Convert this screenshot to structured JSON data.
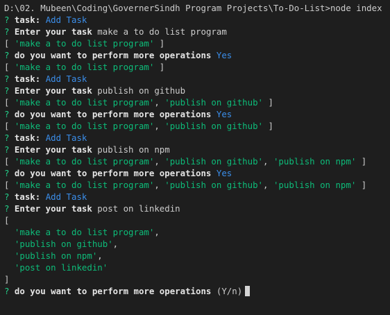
{
  "terminal": {
    "lines": [
      [
        {
          "t": "D:\\02. Mubeen\\Coding\\GovernerSindh Program Projects\\To-Do-List>node index",
          "c": "plain"
        }
      ],
      [
        {
          "t": "? ",
          "c": "q"
        },
        {
          "t": "task:",
          "c": "bold"
        },
        {
          "t": " ",
          "c": "plain"
        },
        {
          "t": "Add Task",
          "c": "ans"
        }
      ],
      [
        {
          "t": "? ",
          "c": "q"
        },
        {
          "t": "Enter your task",
          "c": "bold"
        },
        {
          "t": " make a to do list program",
          "c": "plain"
        }
      ],
      [
        {
          "t": "[ ",
          "c": "plain"
        },
        {
          "t": "'make a to do list program'",
          "c": "str"
        },
        {
          "t": " ]",
          "c": "plain"
        }
      ],
      [
        {
          "t": "? ",
          "c": "q"
        },
        {
          "t": "do you want to perform more operations",
          "c": "bold"
        },
        {
          "t": " ",
          "c": "plain"
        },
        {
          "t": "Yes",
          "c": "ans"
        }
      ],
      [
        {
          "t": "[ ",
          "c": "plain"
        },
        {
          "t": "'make a to do list program'",
          "c": "str"
        },
        {
          "t": " ]",
          "c": "plain"
        }
      ],
      [
        {
          "t": "? ",
          "c": "q"
        },
        {
          "t": "task:",
          "c": "bold"
        },
        {
          "t": " ",
          "c": "plain"
        },
        {
          "t": "Add Task",
          "c": "ans"
        }
      ],
      [
        {
          "t": "? ",
          "c": "q"
        },
        {
          "t": "Enter your task",
          "c": "bold"
        },
        {
          "t": " publish on github",
          "c": "plain"
        }
      ],
      [
        {
          "t": "[ ",
          "c": "plain"
        },
        {
          "t": "'make a to do list program'",
          "c": "str"
        },
        {
          "t": ", ",
          "c": "plain"
        },
        {
          "t": "'publish on github'",
          "c": "str"
        },
        {
          "t": " ]",
          "c": "plain"
        }
      ],
      [
        {
          "t": "? ",
          "c": "q"
        },
        {
          "t": "do you want to perform more operations",
          "c": "bold"
        },
        {
          "t": " ",
          "c": "plain"
        },
        {
          "t": "Yes",
          "c": "ans"
        }
      ],
      [
        {
          "t": "[ ",
          "c": "plain"
        },
        {
          "t": "'make a to do list program'",
          "c": "str"
        },
        {
          "t": ", ",
          "c": "plain"
        },
        {
          "t": "'publish on github'",
          "c": "str"
        },
        {
          "t": " ]",
          "c": "plain"
        }
      ],
      [
        {
          "t": "? ",
          "c": "q"
        },
        {
          "t": "task:",
          "c": "bold"
        },
        {
          "t": " ",
          "c": "plain"
        },
        {
          "t": "Add Task",
          "c": "ans"
        }
      ],
      [
        {
          "t": "? ",
          "c": "q"
        },
        {
          "t": "Enter your task",
          "c": "bold"
        },
        {
          "t": " publish on npm",
          "c": "plain"
        }
      ],
      [
        {
          "t": "[ ",
          "c": "plain"
        },
        {
          "t": "'make a to do list program'",
          "c": "str"
        },
        {
          "t": ", ",
          "c": "plain"
        },
        {
          "t": "'publish on github'",
          "c": "str"
        },
        {
          "t": ", ",
          "c": "plain"
        },
        {
          "t": "'publish on npm'",
          "c": "str"
        },
        {
          "t": " ]",
          "c": "plain"
        }
      ],
      [
        {
          "t": "? ",
          "c": "q"
        },
        {
          "t": "do you want to perform more operations",
          "c": "bold"
        },
        {
          "t": " ",
          "c": "plain"
        },
        {
          "t": "Yes",
          "c": "ans"
        }
      ],
      [
        {
          "t": "[ ",
          "c": "plain"
        },
        {
          "t": "'make a to do list program'",
          "c": "str"
        },
        {
          "t": ", ",
          "c": "plain"
        },
        {
          "t": "'publish on github'",
          "c": "str"
        },
        {
          "t": ", ",
          "c": "plain"
        },
        {
          "t": "'publish on npm'",
          "c": "str"
        },
        {
          "t": " ]",
          "c": "plain"
        }
      ],
      [
        {
          "t": "? ",
          "c": "q"
        },
        {
          "t": "task:",
          "c": "bold"
        },
        {
          "t": " ",
          "c": "plain"
        },
        {
          "t": "Add Task",
          "c": "ans"
        }
      ],
      [
        {
          "t": "? ",
          "c": "q"
        },
        {
          "t": "Enter your task",
          "c": "bold"
        },
        {
          "t": " post on linkedin",
          "c": "plain"
        }
      ],
      [
        {
          "t": "[",
          "c": "plain"
        }
      ],
      [
        {
          "t": "  ",
          "c": "plain"
        },
        {
          "t": "'make a to do list program'",
          "c": "str"
        },
        {
          "t": ",",
          "c": "plain"
        }
      ],
      [
        {
          "t": "  ",
          "c": "plain"
        },
        {
          "t": "'publish on github'",
          "c": "str"
        },
        {
          "t": ",",
          "c": "plain"
        }
      ],
      [
        {
          "t": "  ",
          "c": "plain"
        },
        {
          "t": "'publish on npm'",
          "c": "str"
        },
        {
          "t": ",",
          "c": "plain"
        }
      ],
      [
        {
          "t": "  ",
          "c": "plain"
        },
        {
          "t": "'post on linkedin'",
          "c": "str"
        }
      ],
      [
        {
          "t": "]",
          "c": "plain"
        }
      ],
      [
        {
          "t": "? ",
          "c": "q"
        },
        {
          "t": "do you want to perform more operations",
          "c": "bold"
        },
        {
          "t": " (Y/n)",
          "c": "plain"
        }
      ]
    ]
  },
  "colors": {
    "background": "#1e1e1e",
    "text": "#cccccc",
    "prompt_mark": "#23d18b",
    "answer": "#3b8eea",
    "string": "#0dbc79",
    "bold": "#e5e5e5",
    "cursor": "#d4d4d4"
  }
}
